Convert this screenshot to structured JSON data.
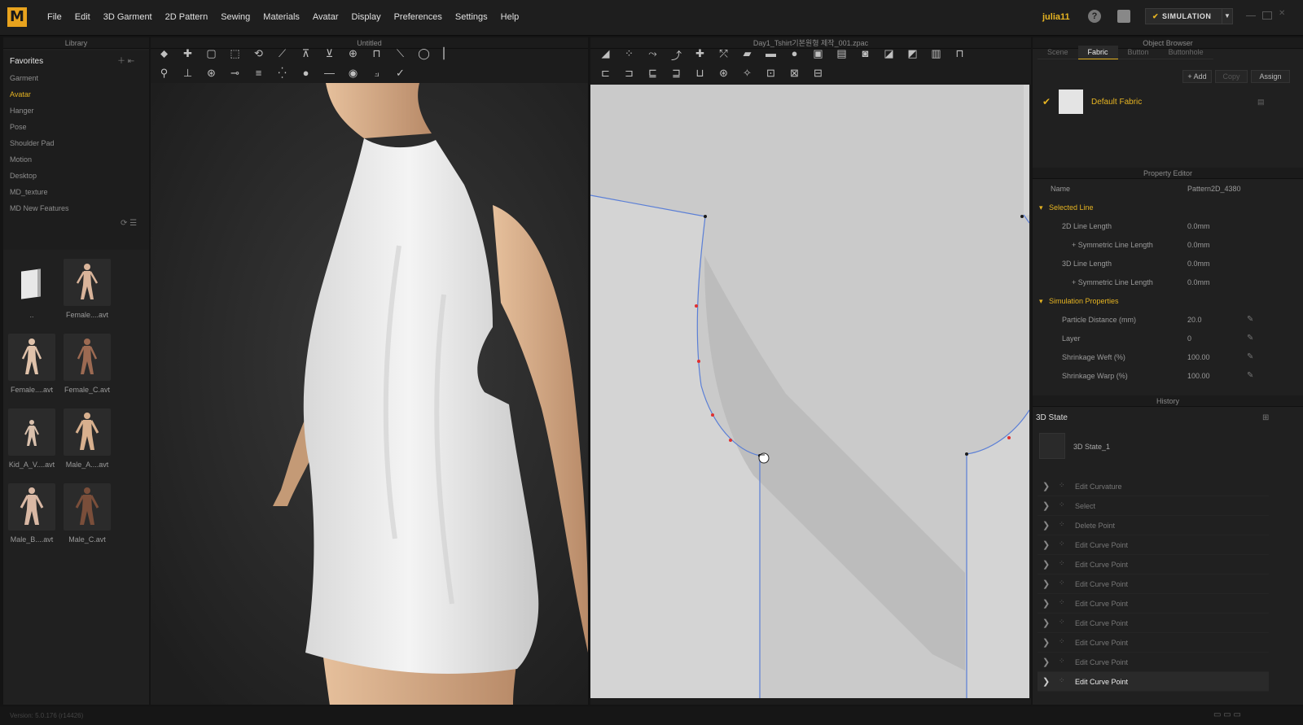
{
  "app": {
    "logo": "M",
    "user": "julia11",
    "simulation_label": "SIMULATION"
  },
  "menu": [
    "File",
    "Edit",
    "3D Garment",
    "2D Pattern",
    "Sewing",
    "Materials",
    "Avatar",
    "Display",
    "Preferences",
    "Settings",
    "Help"
  ],
  "library": {
    "title": "Library",
    "favorites": "Favorites",
    "items": [
      "Garment",
      "Avatar",
      "Hanger",
      "Pose",
      "Shoulder Pad",
      "Motion",
      "Desktop",
      "MD_texture",
      "MD New Features"
    ],
    "selected_item": "Avatar",
    "thumbs": [
      {
        "label": "..",
        "kind": "folder"
      },
      {
        "label": "Female....avt",
        "kind": "female"
      },
      {
        "label": "Female....avt",
        "kind": "female"
      },
      {
        "label": "Female_C.avt",
        "kind": "female-dark"
      },
      {
        "label": "Kid_A_V....avt",
        "kind": "kid"
      },
      {
        "label": "Male_A....avt",
        "kind": "male"
      },
      {
        "label": "Male_B....avt",
        "kind": "male"
      },
      {
        "label": "Male_C.avt",
        "kind": "male-dark"
      }
    ]
  },
  "view3d": {
    "title": "Untitled"
  },
  "view2d": {
    "title": "Day1_Tshirt기본원형 제작_001.zpac"
  },
  "object_browser": {
    "title": "Object Browser",
    "tabs": [
      "Scene",
      "Fabric",
      "Button",
      "Buttonhole"
    ],
    "active_tab": "Fabric",
    "add_label": "+ Add",
    "copy_label": "Copy",
    "assign_label": "Assign",
    "fabric_name": "Default Fabric"
  },
  "property_editor": {
    "title": "Property Editor",
    "name_key": "Name",
    "name_value": "Pattern2D_4380",
    "selected_line": "Selected Line",
    "rows1": [
      {
        "k": "2D Line Length",
        "v": "0.0mm"
      },
      {
        "k": "+ Symmetric Line Length",
        "v": "0.0mm"
      },
      {
        "k": "3D Line Length",
        "v": "0.0mm"
      },
      {
        "k": "+ Symmetric Line Length",
        "v": "0.0mm"
      }
    ],
    "sim_props": "Simulation Properties",
    "rows2": [
      {
        "k": "Particle Distance (mm)",
        "v": "20.0"
      },
      {
        "k": "Layer",
        "v": "0"
      },
      {
        "k": "Shrinkage Weft (%)",
        "v": "100.00"
      },
      {
        "k": "Shrinkage Warp (%)",
        "v": "100.00"
      }
    ]
  },
  "history": {
    "title": "History",
    "state_header": "3D State",
    "state_item": "3D State_1",
    "rows": [
      "Edit Curvature",
      "Select",
      "Delete Point",
      "Edit Curve Point",
      "Edit Curve Point",
      "Edit Curve Point",
      "Edit Curve Point",
      "Edit Curve Point",
      "Edit Curve Point",
      "Edit Curve Point",
      "Edit Curve Point"
    ],
    "current": 10
  },
  "status": {
    "text": "Version: 5.0.176   (r14426)"
  },
  "colors": {
    "accent": "#e6b422",
    "panel": "#202020",
    "canvas2d": "#d4d4d4",
    "pattern_line": "#5b7fd6",
    "point": "#e03030"
  }
}
